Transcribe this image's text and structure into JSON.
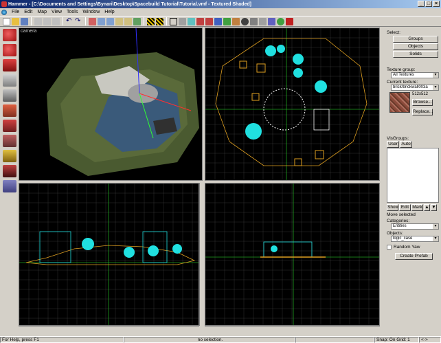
{
  "window": {
    "title": "Hammer - [C:\\Documents and Settings\\Bynari\\Desktop\\Spacebuild Tutorial\\Tutorial.vmf - Textured Shaded]",
    "minimize": "_",
    "maximize": "□",
    "close": "×"
  },
  "menu": [
    "File",
    "Edit",
    "Map",
    "View",
    "Tools",
    "Window",
    "Help"
  ],
  "viewports": {
    "camera_label": "camera"
  },
  "right_panel": {
    "select_label": "Select:",
    "groups": "Groups",
    "objects": "Objects",
    "solids": "Solids",
    "texture_group_label": "Texture group:",
    "texture_group_value": "All Textures",
    "current_texture_label": "Current texture:",
    "current_texture_value": "brick/brickwall003a",
    "texture_size": "512x512",
    "browse": "Browse...",
    "replace": "Replace...",
    "visgroups_label": "VisGroups:",
    "tab_user": "User",
    "tab_auto": "Auto",
    "show": "Show",
    "edit": "Edit",
    "mark": "Mark",
    "move_selected": "Move selected",
    "categories_label": "Categories:",
    "categories_value": "Entities",
    "objects_label": "Objects:",
    "objects_value": "logic_case",
    "random_yaw": "Random Yaw",
    "create_prefab": "Create Prefab"
  },
  "status": {
    "help": "For Help, press F1",
    "selection": "no selection.",
    "snap": "Snap: On Grid: 1",
    "arrows": "<->"
  },
  "colors": {
    "titlebar": "#0a246a",
    "grid_major": "#3a3a3a",
    "brush": "#e0a020",
    "entity": "#20e0e0"
  }
}
